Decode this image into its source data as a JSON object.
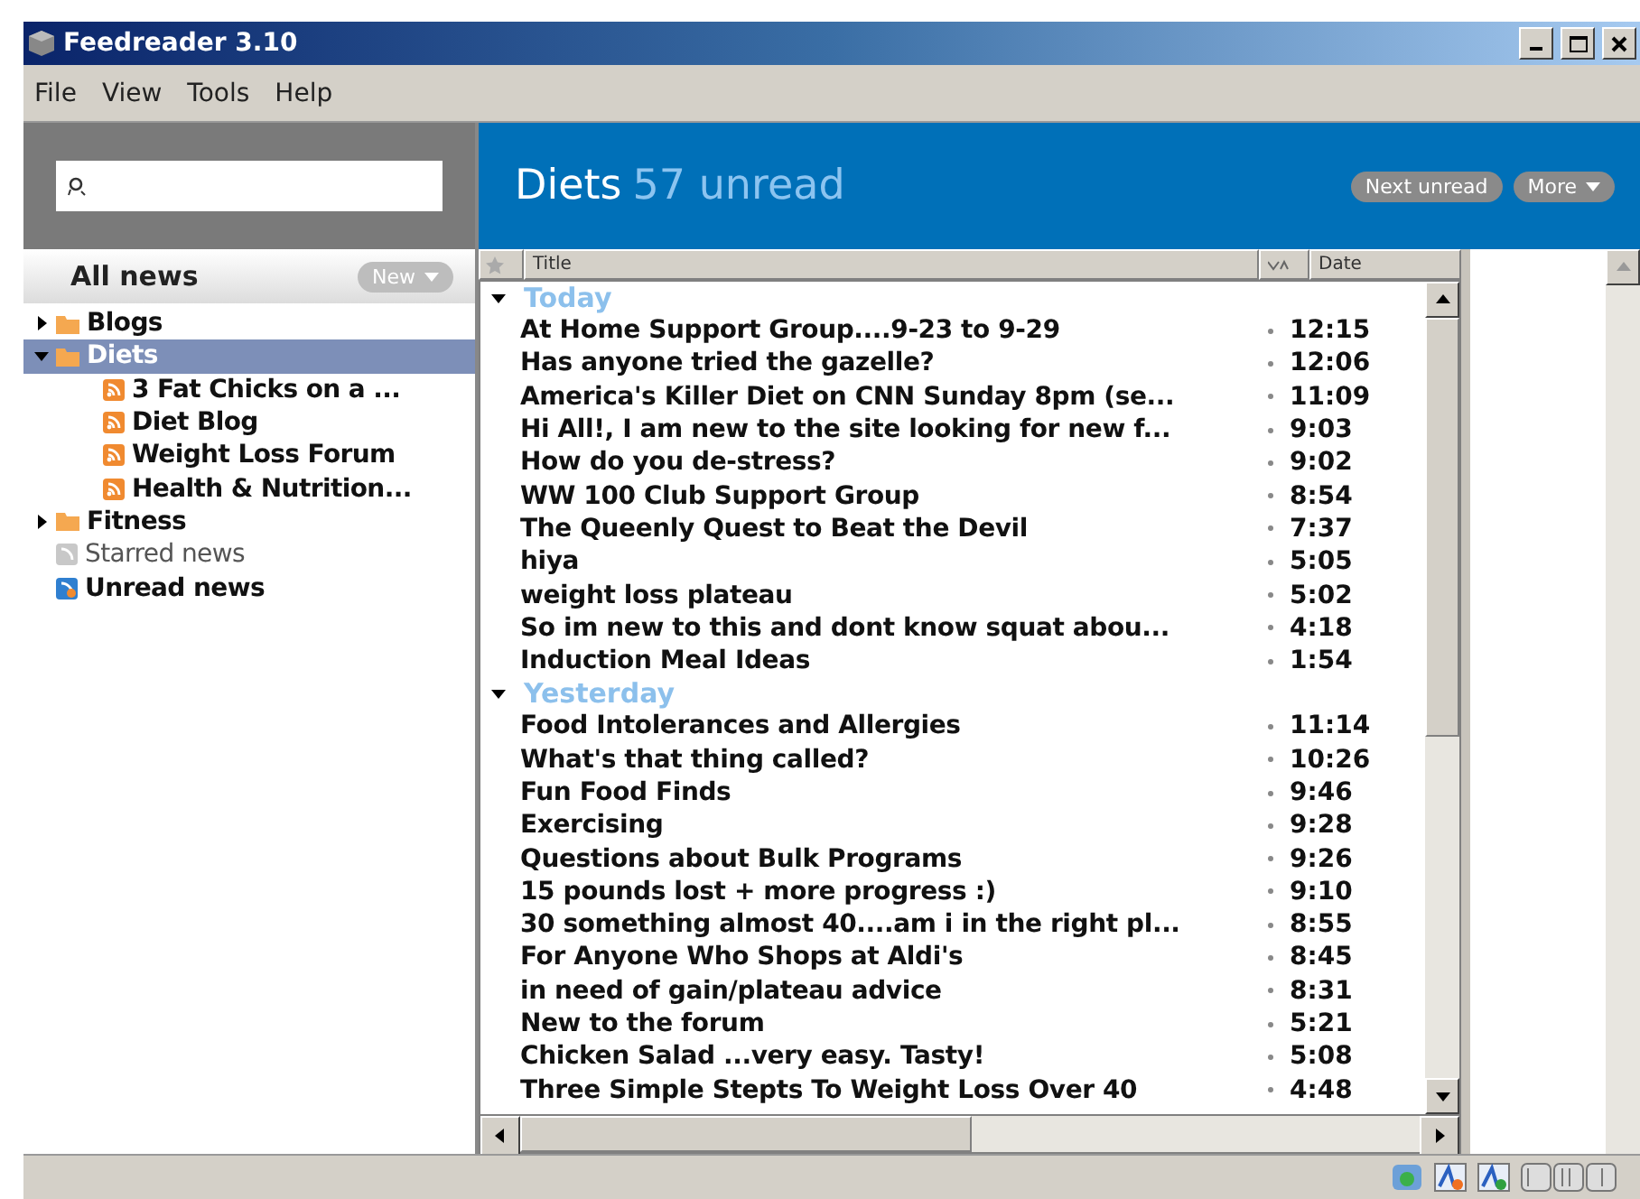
{
  "window": {
    "title": "Feedreader 3.10"
  },
  "menu": [
    "File",
    "View",
    "Tools",
    "Help"
  ],
  "sidebar": {
    "header": "All news",
    "new_button": "New",
    "items": [
      {
        "label": "Blogs",
        "kind": "folder",
        "expanded": false,
        "selected": false,
        "unread": true
      },
      {
        "label": "Diets",
        "kind": "folder",
        "expanded": true,
        "selected": true,
        "unread": true,
        "children": [
          {
            "label": "3 Fat Chicks on a ...",
            "kind": "feed",
            "selected": false,
            "unread": true
          },
          {
            "label": "Diet Blog",
            "kind": "feed",
            "selected": false,
            "unread": true
          },
          {
            "label": "Weight Loss Forum",
            "kind": "feed",
            "selected": false,
            "unread": true
          },
          {
            "label": "Health & Nutrition...",
            "kind": "feed",
            "selected": false,
            "unread": true
          }
        ]
      },
      {
        "label": "Fitness",
        "kind": "folder",
        "expanded": false,
        "selected": false,
        "unread": true
      },
      {
        "label": "Starred news",
        "kind": "starred",
        "selected": false,
        "unread": false
      },
      {
        "label": "Unread news",
        "kind": "unread",
        "selected": false,
        "unread": true
      }
    ]
  },
  "header": {
    "title": "Diets",
    "count": "57 unread",
    "buttons": [
      {
        "label": "Next unread",
        "dropdown": false
      },
      {
        "label": "More",
        "dropdown": true
      }
    ]
  },
  "table": {
    "columns": [
      "Title",
      "Date"
    ],
    "groups": [
      {
        "label": "Today",
        "expanded": true,
        "rows": [
          {
            "title": "At Home Support Group....9-23 to 9-29",
            "date": "12:15"
          },
          {
            "title": "Has anyone tried the gazelle?",
            "date": "12:06"
          },
          {
            "title": "America's Killer Diet on CNN Sunday 8pm (se...",
            "date": "11:09"
          },
          {
            "title": "Hi All!, I am new to the site looking for new f...",
            "date": "9:03"
          },
          {
            "title": "How do you de-stress?",
            "date": "9:02"
          },
          {
            "title": "WW 100 Club Support Group",
            "date": "8:54"
          },
          {
            "title": "The Queenly Quest to Beat the Devil",
            "date": "7:37"
          },
          {
            "title": "hiya",
            "date": "5:05"
          },
          {
            "title": "weight loss plateau",
            "date": "5:02"
          },
          {
            "title": "So im new to this and dont know squat abou...",
            "date": "4:18"
          },
          {
            "title": "Induction Meal Ideas",
            "date": "1:54"
          }
        ]
      },
      {
        "label": "Yesterday",
        "expanded": true,
        "rows": [
          {
            "title": "Food Intolerances and Allergies",
            "date": "11:14"
          },
          {
            "title": "What's that thing called?",
            "date": "10:26"
          },
          {
            "title": "Fun Food Finds",
            "date": "9:46"
          },
          {
            "title": "Exercising",
            "date": "9:28"
          },
          {
            "title": "Questions about Bulk Programs",
            "date": "9:26"
          },
          {
            "title": "15 pounds lost + more progress :)",
            "date": "9:10"
          },
          {
            "title": "30 something almost 40....am i in the right pl...",
            "date": "8:55"
          },
          {
            "title": "For Anyone Who Shops at Aldi's",
            "date": "8:45"
          },
          {
            "title": "in need of gain/plateau advice",
            "date": "8:31"
          },
          {
            "title": "New to the forum",
            "date": "5:21"
          },
          {
            "title": "Chicken Salad ...very easy. Tasty!",
            "date": "5:08"
          },
          {
            "title": "Three Simple Stepts To Weight Loss Over 40",
            "date": "4:48"
          }
        ]
      }
    ]
  }
}
